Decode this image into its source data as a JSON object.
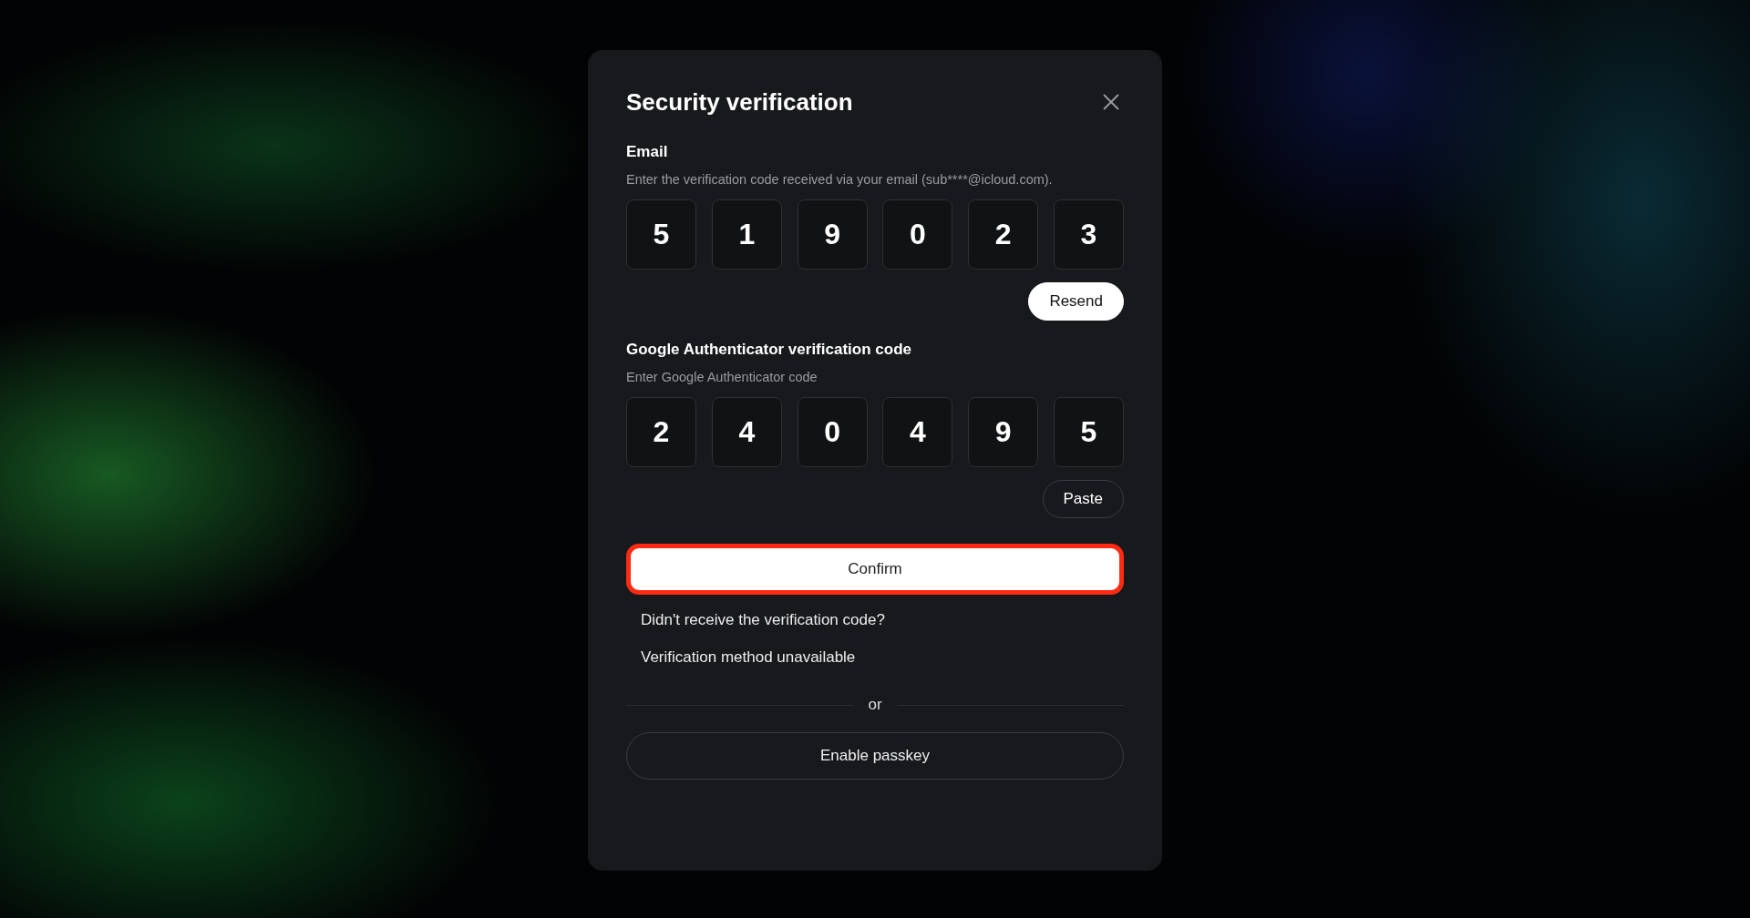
{
  "dialog": {
    "title": "Security verification",
    "sections": [
      {
        "label": "Email",
        "hint": "Enter the verification code received via your email (sub****@icloud.com).",
        "digits": [
          "5",
          "1",
          "9",
          "0",
          "2",
          "3"
        ],
        "action": {
          "label": "Resend",
          "kind": "filled"
        }
      },
      {
        "label": "Google Authenticator verification code",
        "hint": "Enter Google Authenticator code",
        "digits": [
          "2",
          "4",
          "0",
          "4",
          "9",
          "5"
        ],
        "action": {
          "label": "Paste",
          "kind": "outline"
        }
      }
    ],
    "confirm": {
      "label": "Confirm",
      "highlighted": true
    },
    "links": [
      "Didn't receive the verification code?",
      "Verification method unavailable"
    ],
    "divider_text": "or",
    "passkey_button": "Enable passkey"
  }
}
